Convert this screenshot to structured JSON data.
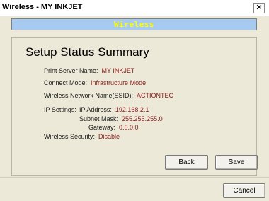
{
  "window": {
    "title": "Wireless - MY INKJET",
    "close_glyph": "✕"
  },
  "banner": {
    "text": "Wireless"
  },
  "summary": {
    "heading": "Setup Status Summary",
    "print_server_name": {
      "label": "Print Server Name:",
      "value": "MY INKJET"
    },
    "connect_mode": {
      "label": "Connect Mode:",
      "value": "Infrastructure Mode"
    },
    "ssid": {
      "label": "Wireless Network Name(SSID):",
      "value": "ACTIONTEC"
    },
    "ip_settings_label": "IP Settings:",
    "ip_address": {
      "label": "IP Address:",
      "value": "192.168.2.1"
    },
    "subnet_mask": {
      "label": "Subnet Mask:",
      "value": "255.255.255.0"
    },
    "gateway": {
      "label": "Gateway:",
      "value": "0.0.0.0"
    },
    "wireless_security": {
      "label": "Wireless Security:",
      "value": "Disable"
    }
  },
  "buttons": {
    "back": "Back",
    "save": "Save",
    "cancel": "Cancel"
  },
  "colors": {
    "value_text": "#8b1a1a",
    "banner_bg": "#a6caf0",
    "banner_text": "#ffff00"
  }
}
